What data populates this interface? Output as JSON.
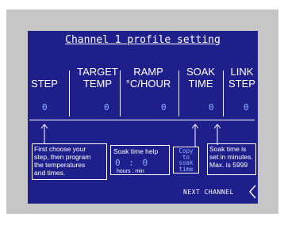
{
  "title": "Channel 1 profile setting",
  "columns": [
    {
      "top": "",
      "bottom": "STEP"
    },
    {
      "top": "TARGET",
      "bottom": "TEMP"
    },
    {
      "top": "RAMP",
      "bottom": "°C/HOUR"
    },
    {
      "top": "SOAK",
      "bottom": "TIME"
    },
    {
      "top": "LINK",
      "bottom": "STEP"
    }
  ],
  "values": [
    "0",
    "0",
    "0",
    "0",
    "0"
  ],
  "help_left": [
    "First choose your",
    "step, then program",
    "the temperatures",
    "and times."
  ],
  "soak_help": {
    "title": "Soak time help",
    "hours": "0",
    "sep": ":",
    "minutes": "0",
    "caption": "hours : min"
  },
  "copy_button": [
    "Copy",
    "to",
    "soak",
    "time"
  ],
  "help_right": [
    "Soak time is",
    "set in minutes.",
    "Max. is 5999"
  ],
  "next_channel": "NEXT CHANNEL",
  "colors": {
    "screen": "#1f1f8c",
    "value": "#8fb3ff",
    "bezel": "#c6c6c6"
  }
}
